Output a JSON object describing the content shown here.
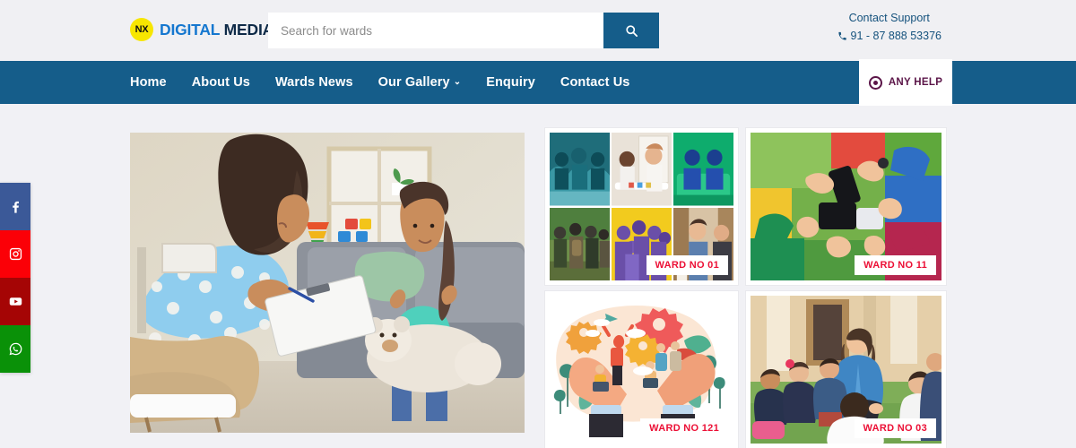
{
  "brand": {
    "mark": "NX",
    "word1": "DIGITAL",
    "word2": "MEDIA"
  },
  "search": {
    "placeholder": "Search for wards",
    "value": "",
    "button_icon": "search-icon"
  },
  "support": {
    "title": "Contact Support",
    "phone": "91 - 87 888 53376",
    "icon": "phone-icon"
  },
  "nav": {
    "items": [
      {
        "label": "Home",
        "has_caret": false
      },
      {
        "label": "About Us",
        "has_caret": false
      },
      {
        "label": "Wards News",
        "has_caret": false
      },
      {
        "label": "Our Gallery",
        "has_caret": true
      },
      {
        "label": "Enquiry",
        "has_caret": false
      },
      {
        "label": "Contact Us",
        "has_caret": false
      }
    ],
    "caret_glyph": "⌄",
    "any_help": {
      "label": "ANY HELP",
      "icon": "target-dot-icon"
    }
  },
  "social": {
    "items": [
      {
        "name": "facebook",
        "label": "f",
        "color": "#3b5998"
      },
      {
        "name": "instagram",
        "label": "",
        "color": "#fb0007"
      },
      {
        "name": "youtube",
        "label": "",
        "color": "#a50505"
      },
      {
        "name": "whatsapp",
        "label": "",
        "color": "#0a9108"
      }
    ]
  },
  "hero": {
    "alt": "Counselor with clipboard talking to a young girl holding a teddy bear on a grey sofa"
  },
  "gallery": {
    "items": [
      {
        "id": "g1",
        "ward": "WARD NO 01",
        "alt": "Six-photo collage: tinted community and family scenes"
      },
      {
        "id": "g2",
        "ward": "WARD NO 11",
        "alt": "Overhead view of people in a circle holding smartphones on colorful mats"
      },
      {
        "id": "g3",
        "ward": "WARD NO 121",
        "alt": "Flat illustration of two hands holding people, gears and plants"
      },
      {
        "id": "g4",
        "ward": "WARD NO 03",
        "alt": "Teacher sitting on grass with children in a circle outdoors"
      }
    ]
  },
  "colors": {
    "nav_blue": "#155d8a",
    "page_bg": "#f1f1f5",
    "topbar_bg": "#f0f0f3",
    "brand_blue": "#1577cf",
    "brand_navy": "#0e2a47",
    "logo_yellow": "#f7e600",
    "ward_red": "#ec0f35",
    "help_purple": "#5b1548"
  }
}
